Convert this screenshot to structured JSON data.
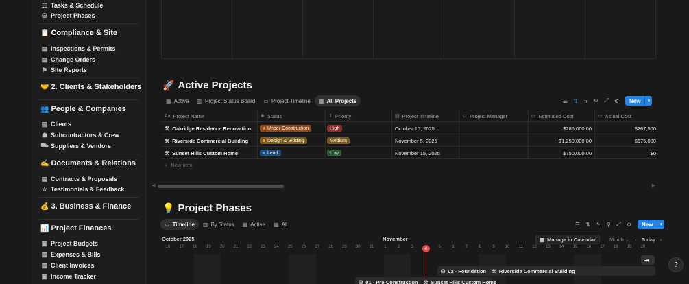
{
  "sidebar": {
    "items": [
      {
        "type": "item",
        "icon": "checklist-icon",
        "glyph": "☷",
        "label": "Tasks & Schedule"
      },
      {
        "type": "item",
        "icon": "phases-icon",
        "glyph": "⛁",
        "label": "Project Phases"
      },
      {
        "type": "heading",
        "emoji": "📋",
        "label": "Compliance & Site"
      },
      {
        "type": "item",
        "icon": "document-icon",
        "glyph": "▤",
        "label": "Inspections & Permits"
      },
      {
        "type": "item",
        "icon": "document-icon",
        "glyph": "▤",
        "label": "Change Orders"
      },
      {
        "type": "item",
        "icon": "flag-icon",
        "glyph": "⚑",
        "label": "Site Reports"
      },
      {
        "type": "heading",
        "emoji": "🤝",
        "label": "2. Clients & Stakeholders"
      },
      {
        "type": "heading",
        "emoji": "👥",
        "label": "People & Companies"
      },
      {
        "type": "item",
        "icon": "document-icon",
        "glyph": "▤",
        "label": "Clients"
      },
      {
        "type": "item",
        "icon": "group-icon",
        "glyph": "☗",
        "label": "Subcontractors & Crew"
      },
      {
        "type": "item",
        "icon": "truck-icon",
        "glyph": "⛟",
        "label": "Suppliers & Vendors"
      },
      {
        "type": "heading",
        "emoji": "✍️",
        "label": "Documents & Relations"
      },
      {
        "type": "item",
        "icon": "document-icon",
        "glyph": "▤",
        "label": "Contracts & Proposals"
      },
      {
        "type": "item",
        "icon": "star-icon",
        "glyph": "☆",
        "label": "Testimonials & Feedback"
      },
      {
        "type": "heading",
        "emoji": "💰",
        "label": "3. Business & Finance"
      },
      {
        "type": "heading",
        "emoji": "📊",
        "label": "Project Finances"
      },
      {
        "type": "item",
        "icon": "money-icon",
        "glyph": "▣",
        "label": "Project Budgets"
      },
      {
        "type": "item",
        "icon": "document-icon",
        "glyph": "▤",
        "label": "Expenses & Bills"
      },
      {
        "type": "item",
        "icon": "document-icon",
        "glyph": "▤",
        "label": "Client Invoices"
      },
      {
        "type": "item",
        "icon": "money-icon",
        "glyph": "▣",
        "label": "Income Tracker"
      }
    ]
  },
  "active_projects": {
    "emoji": "🚀",
    "title": "Active Projects",
    "tabs": [
      {
        "label": "Active",
        "glyph": "▦",
        "active": false
      },
      {
        "label": "Project Status Board",
        "glyph": "▥",
        "active": false
      },
      {
        "label": "Project Timeline",
        "glyph": "▭",
        "active": false
      },
      {
        "label": "All Projects",
        "glyph": "▦",
        "active": true
      }
    ],
    "new_label": "New",
    "columns": [
      {
        "icon": "Aa",
        "label": "Project Name"
      },
      {
        "icon": "✺",
        "label": "Status"
      },
      {
        "icon": "⇑",
        "label": "Priority"
      },
      {
        "icon": "▤",
        "label": "Project Timeline"
      },
      {
        "icon": "☺",
        "label": "Project Manager"
      },
      {
        "icon": "▭",
        "label": "Estimated Cost"
      },
      {
        "icon": "▭",
        "label": "Actual Cost"
      }
    ],
    "rows": [
      {
        "name": "Oakridge Residence Renovation",
        "status": "Under Construction",
        "status_color": "#8a4a1f",
        "status_dot": "#e08a4a",
        "priority": "High",
        "priority_color": "#8a2e2e",
        "timeline": "October 15, 2025",
        "manager": "",
        "estimated": "$285,000.00",
        "actual": "$267,500"
      },
      {
        "name": "Riverside Commercial Building",
        "status": "Design & Bidding",
        "status_color": "#7a5a1a",
        "status_dot": "#e0b04a",
        "priority": "Medium",
        "priority_color": "#7a5a1a",
        "timeline": "November 5, 2025",
        "manager": "",
        "estimated": "$1,250,000.00",
        "actual": "$175,000"
      },
      {
        "name": "Sunset Hills Custom Home",
        "status": "Lead",
        "status_color": "#1f4f7a",
        "status_dot": "#5aa0e6",
        "priority": "Low",
        "priority_color": "#2b5a36",
        "timeline": "November 15, 2025",
        "manager": "",
        "estimated": "$750,000.00",
        "actual": "$0"
      }
    ],
    "new_item_label": "New item"
  },
  "project_phases": {
    "emoji": "💡",
    "title": "Project Phases",
    "tabs": [
      {
        "label": "Timeline",
        "glyph": "▭",
        "active": true
      },
      {
        "label": "By Status",
        "glyph": "▥",
        "active": false
      },
      {
        "label": "Active",
        "glyph": "▦",
        "active": false
      },
      {
        "label": "All",
        "glyph": "▦",
        "active": false
      }
    ],
    "new_label": "New",
    "timeline": {
      "month_left": "October 2025",
      "month_right": "November",
      "manage_label": "Manage in Calendar",
      "scale_label": "Month",
      "today_label": "Today",
      "days": [
        "16",
        "17",
        "18",
        "19",
        "20",
        "21",
        "22",
        "23",
        "24",
        "25",
        "26",
        "27",
        "28",
        "29",
        "30",
        "31",
        "1",
        "2",
        "3",
        "4",
        "5",
        "6",
        "7",
        "8",
        "9",
        "10",
        "11",
        "12",
        "13",
        "14",
        "15",
        "16",
        "17",
        "18",
        "19",
        "20"
      ],
      "today": "4",
      "bars": [
        {
          "label": "02 - Foundation",
          "project": "Riverside Commercial Building"
        },
        {
          "label": "01 - Pre-Construction",
          "project": "Sunset Hills Custom Home"
        }
      ]
    }
  },
  "help_label": "?"
}
